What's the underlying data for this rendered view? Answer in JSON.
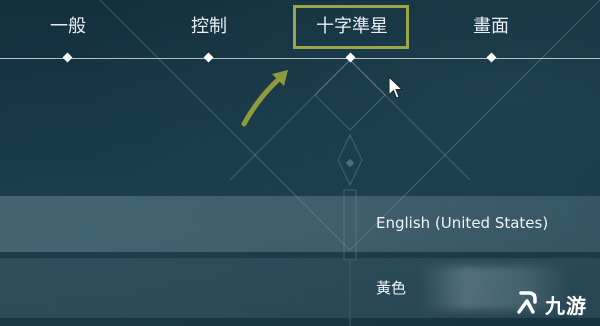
{
  "tabs": [
    {
      "label": "一般",
      "selected": false
    },
    {
      "label": "控制",
      "selected": false
    },
    {
      "label": "十字準星",
      "selected": true
    },
    {
      "label": "畫面",
      "selected": false
    }
  ],
  "settings": {
    "language_value": "English (United States)",
    "color_value": "黃色"
  },
  "watermark": {
    "text": "九游"
  },
  "colors": {
    "highlight_border": "#9aa54a",
    "annotation_arrow": "#8e9a3c",
    "background": "#163645"
  }
}
